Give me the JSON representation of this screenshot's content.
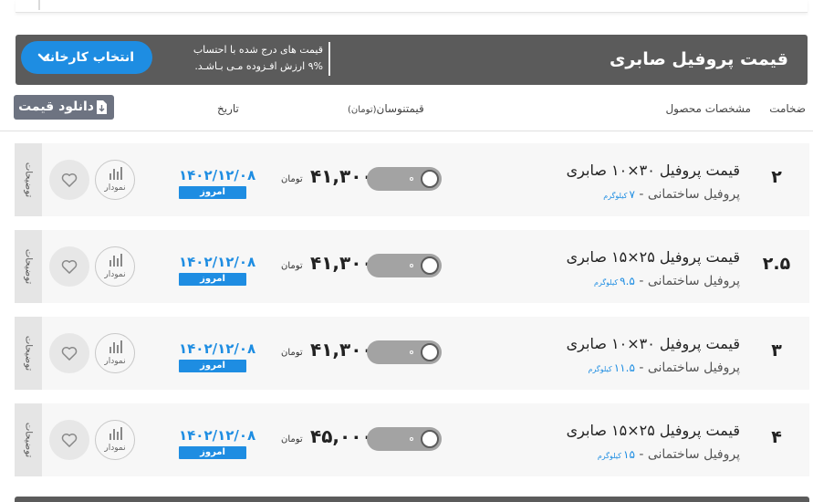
{
  "header": {
    "title": "قیمت پروفیل صابری",
    "note_line1": "قیمت های درج شده با احتساب",
    "note_line2": "۹% ارزش افـزوده مـی بـاشـد.",
    "select_button": "انتخاب کارخانه",
    "select_icon": "chevron-down-icon"
  },
  "download_button": {
    "label": "دانلود قیمت",
    "icon": "file-download-icon"
  },
  "columns": {
    "thickness": "ضخامت",
    "specs": "مشخصات محصول",
    "price": "قیمت",
    "fluctuation": "نوسان",
    "unit": "(تومان)",
    "date": "تاریخ"
  },
  "colors": {
    "accent": "#1e8de2",
    "header_bg": "#5b5b5b",
    "row_bg": "#f7f7f7"
  },
  "rows": [
    {
      "thickness": "۲",
      "name": "قیمت پروفیل ۳۰×۱۰ صابری",
      "category": "پروفیل ساختمانی - ",
      "weight": "۷",
      "weight_unit": "کیلوگرم",
      "price": "۴۱,۳۰۰",
      "unit": "تومان",
      "date": "۱۴۰۲/۱۲/۰۸",
      "badge": "امروز",
      "chart_label": "نمودار",
      "side_tab": "توضیحات"
    },
    {
      "thickness": "۲.۵",
      "name": "قیمت پروفیل ۲۵×۱۵ صابری",
      "category": "پروفیل ساختمانی - ",
      "weight": "۹.۵",
      "weight_unit": "کیلوگرم",
      "price": "۴۱,۳۰۰",
      "unit": "تومان",
      "date": "۱۴۰۲/۱۲/۰۸",
      "badge": "امروز",
      "chart_label": "نمودار",
      "side_tab": "توضیحات"
    },
    {
      "thickness": "۳",
      "name": "قیمت پروفیل ۳۰×۱۰ صابری",
      "category": "پروفیل ساختمانی - ",
      "weight": "۱۱.۵",
      "weight_unit": "کیلوگرم",
      "price": "۴۱,۳۰۰",
      "unit": "تومان",
      "date": "۱۴۰۲/۱۲/۰۸",
      "badge": "امروز",
      "chart_label": "نمودار",
      "side_tab": "توضیحات"
    },
    {
      "thickness": "۴",
      "name": "قیمت پروفیل ۲۵×۱۵ صابری",
      "category": "پروفیل ساختمانی - ",
      "weight": "۱۵",
      "weight_unit": "کیلوگرم",
      "price": "۴۵,۰۰۰",
      "unit": "تومان",
      "date": "۱۴۰۲/۱۲/۰۸",
      "badge": "امروز",
      "chart_label": "نمودار",
      "side_tab": "توضیحات"
    }
  ]
}
